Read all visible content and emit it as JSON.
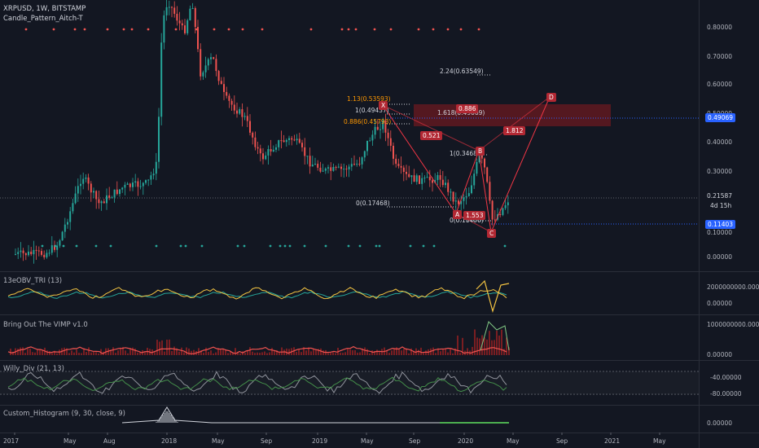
{
  "header": {
    "symbol_line": "XRPUSD, 1W, BITSTAMP",
    "indicator_line": "Candle_Pattern_Aitch-T"
  },
  "price_axis": {
    "ticks": [
      "0.80000",
      "0.70000",
      "0.60000",
      "0.50000",
      "0.40000",
      "0.30000",
      "0.20000",
      "0.10000",
      "0.00000"
    ],
    "current_price": "0.21587",
    "countdown": "4d 15h",
    "price_line_1": "0.49069",
    "price_line_2": "0.11403"
  },
  "time_axis": {
    "labels": [
      "2017",
      "May",
      "Aug",
      "2018",
      "May",
      "Sep",
      "2019",
      "May",
      "Sep",
      "2020",
      "May",
      "Sep",
      "2021",
      "May"
    ]
  },
  "pattern": {
    "points": [
      "X",
      "A",
      "B",
      "C",
      "D"
    ],
    "levels": [
      {
        "text": "1.13(0.53593)",
        "color": "#ff9800"
      },
      {
        "text": "1(0.49437)",
        "color": "#d1d4dc"
      },
      {
        "text": "0.886(0.45793)",
        "color": "#ff9800"
      },
      {
        "text": "2.24(0.63549)",
        "color": "#d1d4dc"
      },
      {
        "text": "1.618(0.49069)",
        "color": "#d1d4dc"
      },
      {
        "text": "1(0.34681)",
        "color": "#d1d4dc"
      },
      {
        "text": "0(0.17468)",
        "color": "#d1d4dc"
      },
      {
        "text": "0(0.11400)",
        "color": "#d1d4dc"
      }
    ],
    "ratios": [
      "0.886",
      "0.521",
      "1.812",
      "1.553"
    ]
  },
  "panes": [
    {
      "title": "13eOBV_TRI (13)",
      "ticks": [
        "2000000000.00000",
        "0.00000"
      ]
    },
    {
      "title": "Bring Out The VIMP v1.0",
      "ticks": [
        "1000000000.00000",
        "0.00000"
      ]
    },
    {
      "title": "Willy_Div (21, 13)",
      "ticks": [
        "-40.00000",
        "-80.00000"
      ]
    },
    {
      "title": "Custom_Histogram (9, 30, close, 9)",
      "ticks": [
        "0.00000"
      ]
    }
  ],
  "colors": {
    "background": "#131722",
    "up": "#26a69a",
    "down": "#ef5350",
    "pattern": "#f23645",
    "price_badge": "#2962ff"
  }
}
